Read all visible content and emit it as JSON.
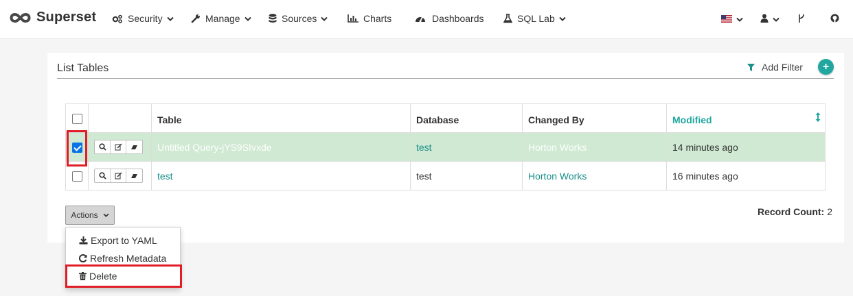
{
  "navbar": {
    "brand": "Superset",
    "menus": [
      {
        "label": "Security",
        "icon": "cogs-icon",
        "dropdown": true
      },
      {
        "label": "Manage",
        "icon": "wrench-icon",
        "dropdown": true
      },
      {
        "label": "Sources",
        "icon": "database-icon",
        "dropdown": true
      },
      {
        "label": "Charts",
        "icon": "bar-chart-icon",
        "dropdown": false
      },
      {
        "label": "Dashboards",
        "icon": "dashboard-icon",
        "dropdown": false
      },
      {
        "label": "SQL Lab",
        "icon": "flask-icon",
        "dropdown": true
      }
    ],
    "right_icons": [
      "us-flag-icon",
      "user-icon",
      "code-fork-icon",
      "github-icon"
    ]
  },
  "panel": {
    "title": "List Tables",
    "add_filter_label": "Add Filter",
    "add_button_label": "+"
  },
  "table": {
    "columns": [
      "Table",
      "Database",
      "Changed By",
      "Modified"
    ],
    "sorted_column": "Modified",
    "rows": [
      {
        "table": "Untitled Query-jYS9SIvxde",
        "database": "test",
        "changed_by": "Horton Works",
        "modified": "14 minutes ago",
        "checked": true
      },
      {
        "table": "test",
        "database": "test",
        "changed_by": "Horton Works",
        "modified": "16 minutes ago",
        "checked": false
      }
    ]
  },
  "actions": {
    "button_label": "Actions",
    "menu": [
      {
        "label": "Export to YAML",
        "icon": "download-icon"
      },
      {
        "label": "Refresh Metadata",
        "icon": "refresh-icon"
      },
      {
        "label": "Delete",
        "icon": "trash-icon"
      }
    ]
  },
  "record_count": {
    "label": "Record Count:",
    "value": "2"
  },
  "colors": {
    "accent": "#20a7a0",
    "selected_row": "#cfe9d2",
    "highlight": "#e01d26"
  }
}
